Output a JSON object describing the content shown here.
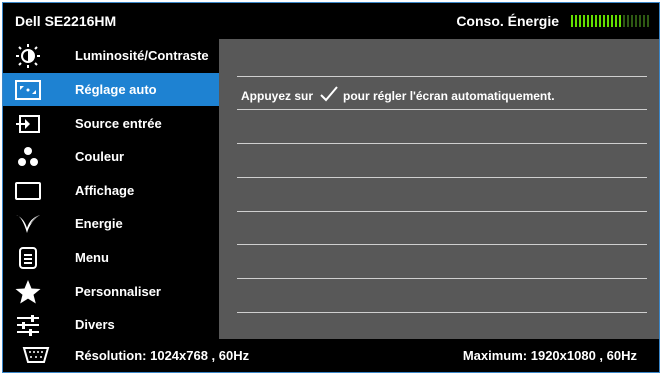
{
  "header": {
    "model": "Dell  SE2216HM",
    "energy_label": "Conso. Énergie",
    "energy_level": 0.65
  },
  "sidebar": {
    "items": [
      {
        "label": "Luminosité/Contraste",
        "icon": "brightness-icon"
      },
      {
        "label": "Réglage auto",
        "icon": "auto-adjust-icon",
        "active": true
      },
      {
        "label": "Source entrée",
        "icon": "input-source-icon"
      },
      {
        "label": "Couleur",
        "icon": "color-icon"
      },
      {
        "label": "Affichage",
        "icon": "display-icon"
      },
      {
        "label": "Energie",
        "icon": "energy-leaf-icon"
      },
      {
        "label": "Menu",
        "icon": "menu-icon"
      },
      {
        "label": "Personnaliser",
        "icon": "star-icon"
      },
      {
        "label": "Divers",
        "icon": "sliders-icon"
      }
    ]
  },
  "content": {
    "instruction_before": "Appuyez sur",
    "instruction_after": "pour régler l'écran automatiquement."
  },
  "footer": {
    "resolution": "Résolution: 1024x768 , 60Hz",
    "maximum": "Maximum: 1920x1080 , 60Hz"
  },
  "colors": {
    "accent": "#1e82d2",
    "energy_on": "#66dd00",
    "energy_off": "#2e5a12"
  }
}
